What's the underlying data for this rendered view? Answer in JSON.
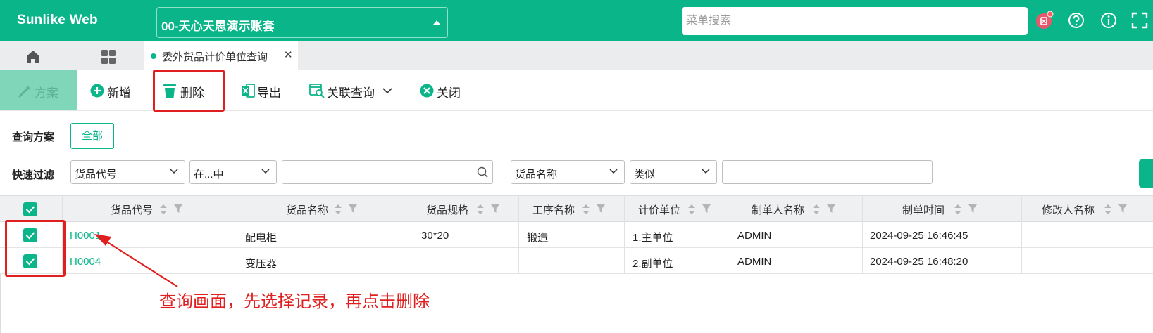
{
  "header": {
    "app_name": "Sunlike Web",
    "account": "00-天心天思演示账套",
    "search_placeholder": "菜单搜索",
    "icons": [
      "notification-icon",
      "help-icon",
      "info-icon",
      "fullscreen-icon"
    ],
    "accent_color": "#0bb58a"
  },
  "tabs": {
    "active_tab": "委外货品计价单位查询",
    "close_glyph": "✕"
  },
  "toolbar": {
    "scheme": "方案",
    "add": "新增",
    "delete": "删除",
    "export": "导出",
    "related_query": "关联查询",
    "close": "关闭"
  },
  "filters": {
    "scheme_label": "查询方案",
    "all_button": "全部",
    "quick_filter_label": "快速过滤",
    "field1": "货品代号",
    "op1": "在...中",
    "value1": "",
    "field2": "货品名称",
    "op2": "类似",
    "value2": ""
  },
  "table": {
    "columns": [
      "货品代号",
      "货品名称",
      "货品规格",
      "工序名称",
      "计价单位",
      "制单人名称",
      "制单时间",
      "修改人名称"
    ],
    "rows": [
      {
        "code": "H0001",
        "name": "配电柜",
        "spec": "30*20",
        "process": "锻造",
        "unit": "1.主单位",
        "creator": "ADMIN",
        "time": "2024-09-25 16:46:45",
        "modifier": "",
        "checked": true
      },
      {
        "code": "H0004",
        "name": "变压器",
        "spec": "",
        "process": "",
        "unit": "2.副单位",
        "creator": "ADMIN",
        "time": "2024-09-25 16:48:20",
        "modifier": "",
        "checked": true
      }
    ]
  },
  "annotation": {
    "text": "查询画面，先选择记录，再点击删除",
    "color": "#e02020"
  }
}
